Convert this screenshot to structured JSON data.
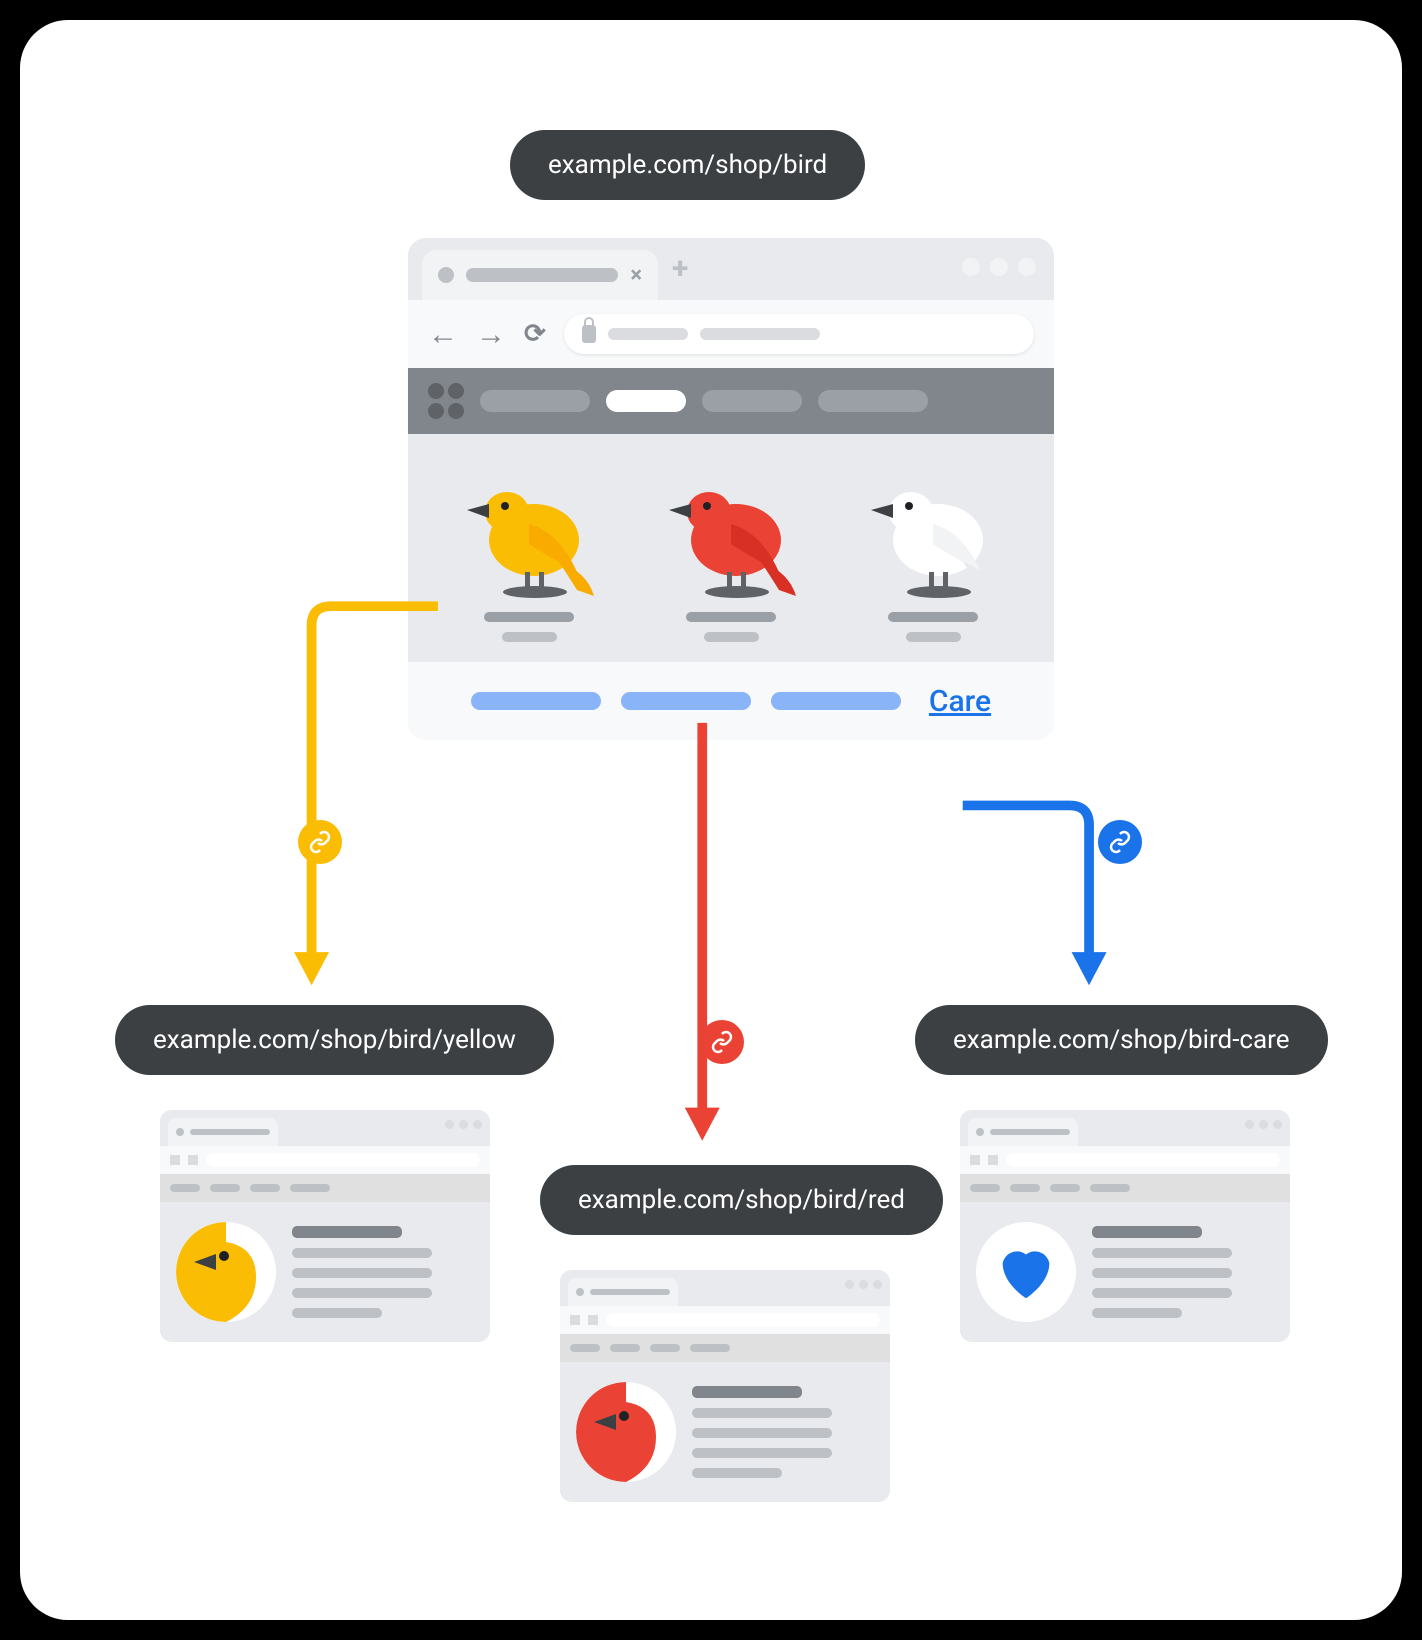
{
  "urls": {
    "root": "example.com/shop/bird",
    "yellow": "example.com/shop/bird/yellow",
    "red": "example.com/shop/bird/red",
    "care": "example.com/shop/bird-care"
  },
  "browser": {
    "care_label": "Care"
  },
  "colors": {
    "yellow": "#fbbc04",
    "red": "#ea4335",
    "blue": "#1a73e8",
    "lightblue": "#8ab4f8"
  },
  "birds": [
    {
      "name": "yellow",
      "body": "#fbbc04",
      "wing": "#f9ab00"
    },
    {
      "name": "red",
      "body": "#ea4335",
      "wing": "#d93025"
    },
    {
      "name": "white",
      "body": "#ffffff",
      "wing": "#f1f3f4"
    }
  ]
}
